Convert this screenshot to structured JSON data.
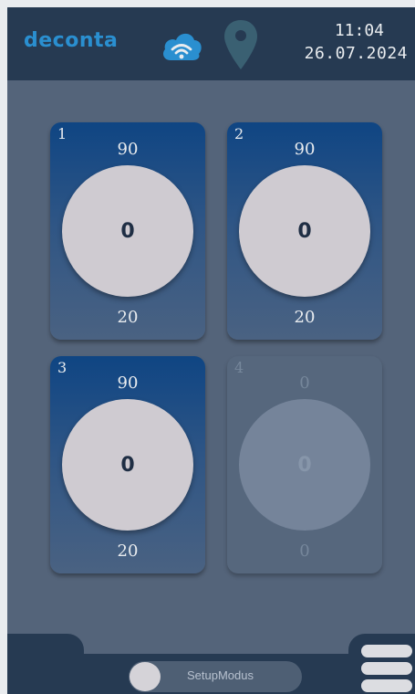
{
  "header": {
    "brand": "deconta",
    "time": "11:04",
    "date": "26.07.2024",
    "icons": [
      "cloud-wifi-icon",
      "location-pin-icon"
    ]
  },
  "tiles": [
    {
      "number": "1",
      "top": "90",
      "value": "0",
      "bottom": "20",
      "active": true
    },
    {
      "number": "2",
      "top": "90",
      "value": "0",
      "bottom": "20",
      "active": true
    },
    {
      "number": "3",
      "top": "90",
      "value": "0",
      "bottom": "20",
      "active": true
    },
    {
      "number": "4",
      "top": "0",
      "value": "0",
      "bottom": "0",
      "active": false
    }
  ],
  "footer": {
    "toggle_label": "SetupModus",
    "menu_icon": "hamburger-menu-icon"
  },
  "colors": {
    "background": "#54647a",
    "header": "#263a52",
    "brand": "#2a8fd0",
    "tile_gradient_top": "#0f4583",
    "gauge": "#cfcbd1"
  }
}
